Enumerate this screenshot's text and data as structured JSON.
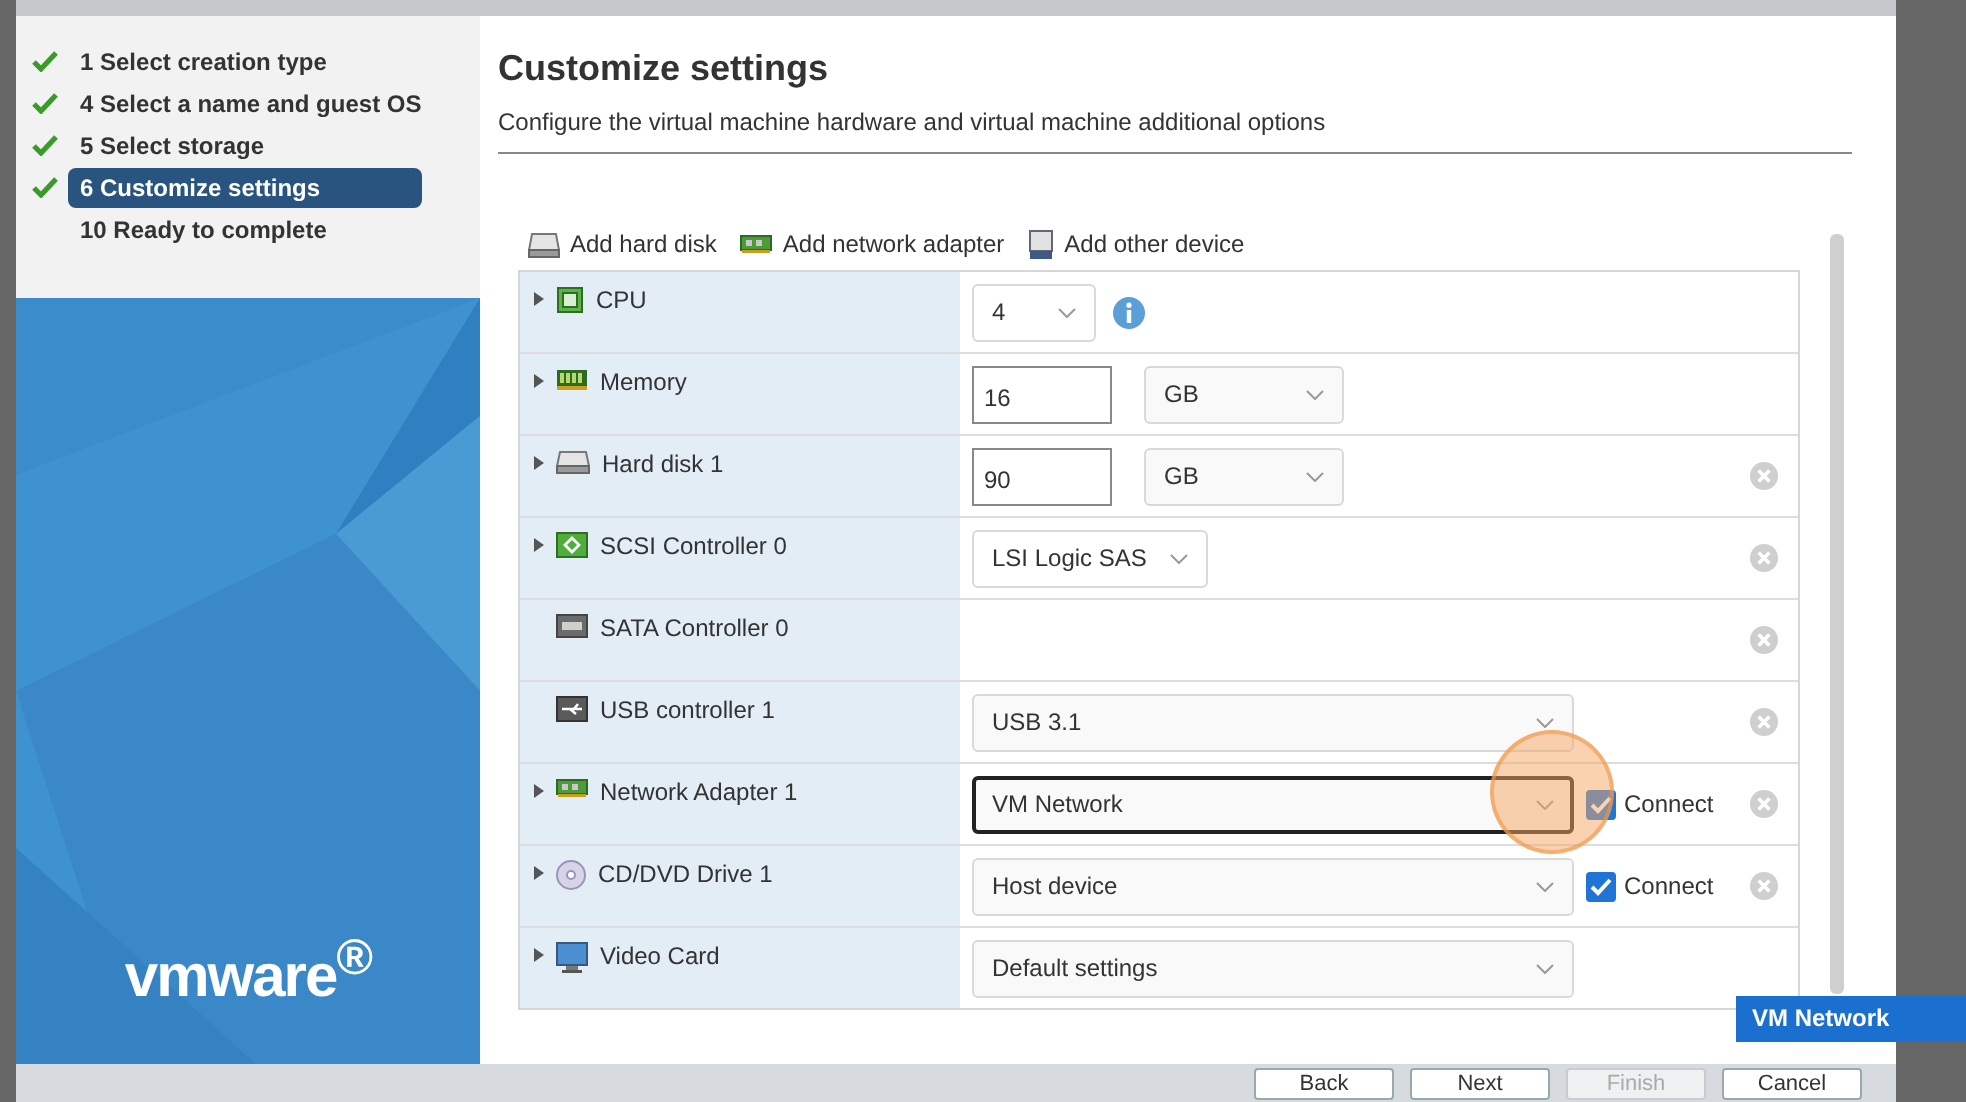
{
  "steps": [
    {
      "number": "1",
      "label": "Select creation type",
      "done": true,
      "selected": false
    },
    {
      "number": "4",
      "label": "Select a name and guest OS",
      "done": true,
      "selected": false
    },
    {
      "number": "5",
      "label": "Select storage",
      "done": true,
      "selected": false
    },
    {
      "number": "6",
      "label": "Customize settings",
      "done": true,
      "selected": true
    },
    {
      "number": "10",
      "label": "Ready to complete",
      "done": false,
      "selected": false
    }
  ],
  "logo": "vmware$^{®}$",
  "title": "Customize settings",
  "subtitle": "Configure the virtual machine hardware and virtual machine additional options",
  "toolbar": [
    "Add hard disk",
    "Add network adapter",
    "Add other device"
  ],
  "devices": [
    {
      "name": "CPU",
      "expandable": true,
      "kind": "select",
      "value": "4",
      "wide": false,
      "info": true,
      "removable": false
    },
    {
      "name": "Memory",
      "expandable": true,
      "kind": "size",
      "value": "16",
      "unit": "GB",
      "removable": false
    },
    {
      "name": "Hard disk 1",
      "expandable": true,
      "kind": "size",
      "value": "90",
      "unit": "GB",
      "removable": true
    },
    {
      "name": "SCSI Controller 0",
      "expandable": true,
      "kind": "select",
      "value": "LSI Logic SAS",
      "wide": false,
      "info": false,
      "removable": true
    },
    {
      "name": "SATA Controller 0",
      "expandable": false,
      "kind": "none",
      "removable": true
    },
    {
      "name": "USB controller 1",
      "expandable": false,
      "kind": "select",
      "value": "USB 3.1",
      "wide": true,
      "info": false,
      "removable": true
    },
    {
      "name": "Network Adapter 1",
      "expandable": true,
      "kind": "select",
      "value": "VM Network",
      "wide": true,
      "focused": true,
      "info": false,
      "connect": {
        "label": "Connect",
        "checked": true
      },
      "removable": true
    },
    {
      "name": "CD/DVD Drive 1",
      "expandable": true,
      "kind": "select",
      "value": "Host device",
      "wide": true,
      "info": false,
      "connect": {
        "label": "Connect",
        "checked": true
      },
      "removable": true
    },
    {
      "name": "Video Card",
      "expandable": true,
      "kind": "select",
      "value": "Default settings",
      "wide": true,
      "info": false,
      "removable": false
    }
  ],
  "dropdown_menu": {
    "items": [
      {
        "label": "VM Network",
        "selected": true
      }
    ]
  },
  "buttons": [
    {
      "label": "Back",
      "disabled": false
    },
    {
      "label": "Next",
      "disabled": false
    },
    {
      "label": "Finish",
      "disabled": true
    },
    {
      "label": "Cancel",
      "disabled": false
    }
  ]
}
